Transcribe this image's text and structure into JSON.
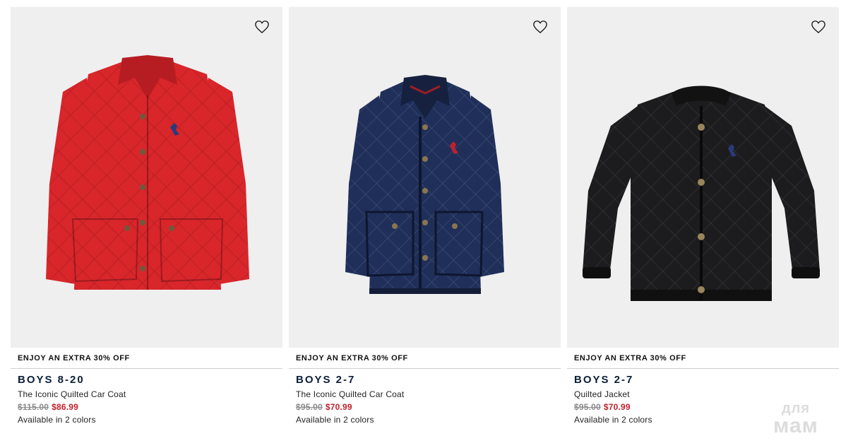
{
  "products": [
    {
      "promo": "ENJOY AN EXTRA 30% OFF",
      "category": "BOYS 8-20",
      "name": "The Iconic Quilted Car Coat",
      "original_price": "$115.00",
      "sale_price": "$86.99",
      "colors_text": "Available in 2 colors",
      "jacket_color": "#d8262b",
      "collar_color": "#b61d22",
      "wishlist_icon": "heart-outline-icon"
    },
    {
      "promo": "ENJOY AN EXTRA 30% OFF",
      "category": "BOYS 2-7",
      "name": "The Iconic Quilted Car Coat",
      "original_price": "$95.00",
      "sale_price": "$70.99",
      "colors_text": "Available in 2 colors",
      "jacket_color": "#1f2f5a",
      "collar_color": "#16213f",
      "wishlist_icon": "heart-outline-icon"
    },
    {
      "promo": "ENJOY AN EXTRA 30% OFF",
      "category": "BOYS 2-7",
      "name": "Quilted Jacket",
      "original_price": "$95.00",
      "sale_price": "$70.99",
      "colors_text": "Available in 2 colors",
      "jacket_color": "#1c1c1e",
      "collar_color": "#121213",
      "wishlist_icon": "heart-outline-icon"
    }
  ],
  "watermark": {
    "line1": "для",
    "line2": "мам"
  },
  "colors": {
    "sale_red": "#c0202c",
    "category_navy": "#0b1f38",
    "image_bg": "#efefef"
  }
}
